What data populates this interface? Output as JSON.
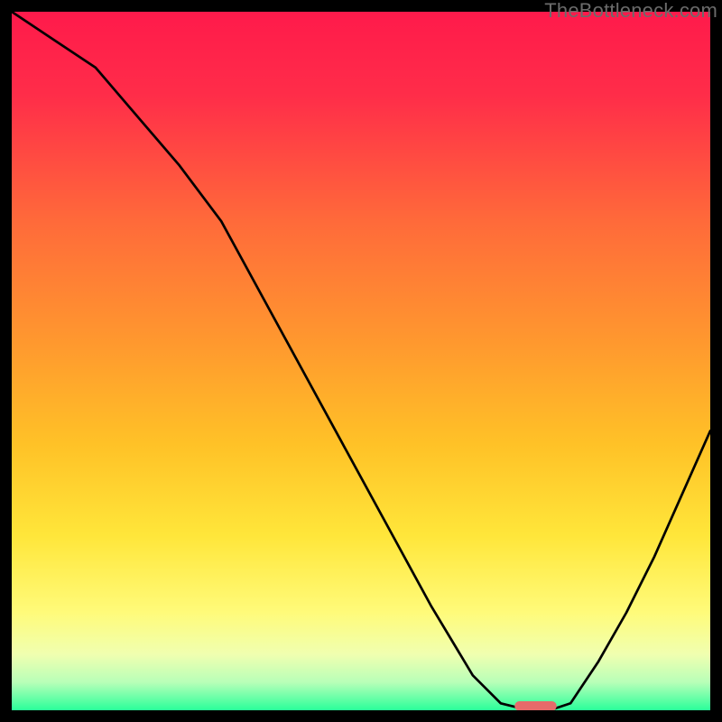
{
  "watermark": "TheBottleneck.com",
  "chart_data": {
    "type": "line",
    "title": "",
    "xlabel": "",
    "ylabel": "",
    "xlim": [
      0,
      100
    ],
    "ylim": [
      0,
      100
    ],
    "grid": false,
    "background_gradient": {
      "stops": [
        {
          "pos": 0.0,
          "color": "#ff1a4b"
        },
        {
          "pos": 0.12,
          "color": "#ff2d49"
        },
        {
          "pos": 0.3,
          "color": "#ff6a3a"
        },
        {
          "pos": 0.48,
          "color": "#ff9a2e"
        },
        {
          "pos": 0.62,
          "color": "#ffc227"
        },
        {
          "pos": 0.75,
          "color": "#ffe63a"
        },
        {
          "pos": 0.86,
          "color": "#fffb7a"
        },
        {
          "pos": 0.92,
          "color": "#f0ffb0"
        },
        {
          "pos": 0.96,
          "color": "#b8ffb8"
        },
        {
          "pos": 1.0,
          "color": "#2aff9a"
        }
      ]
    },
    "series": [
      {
        "name": "bottleneck-curve",
        "color": "#000000",
        "x": [
          0,
          6,
          12,
          18,
          24,
          30,
          36,
          42,
          48,
          54,
          60,
          66,
          70,
          74,
          77,
          80,
          84,
          88,
          92,
          96,
          100
        ],
        "y": [
          100,
          96,
          92,
          85,
          78,
          70,
          59,
          48,
          37,
          26,
          15,
          5,
          1,
          0,
          0,
          1,
          7,
          14,
          22,
          31,
          40
        ]
      }
    ],
    "marker": {
      "name": "optimal-range",
      "color": "#e66a6a",
      "x_range": [
        72,
        78
      ],
      "y": 0.6,
      "thickness": 1.4
    }
  }
}
